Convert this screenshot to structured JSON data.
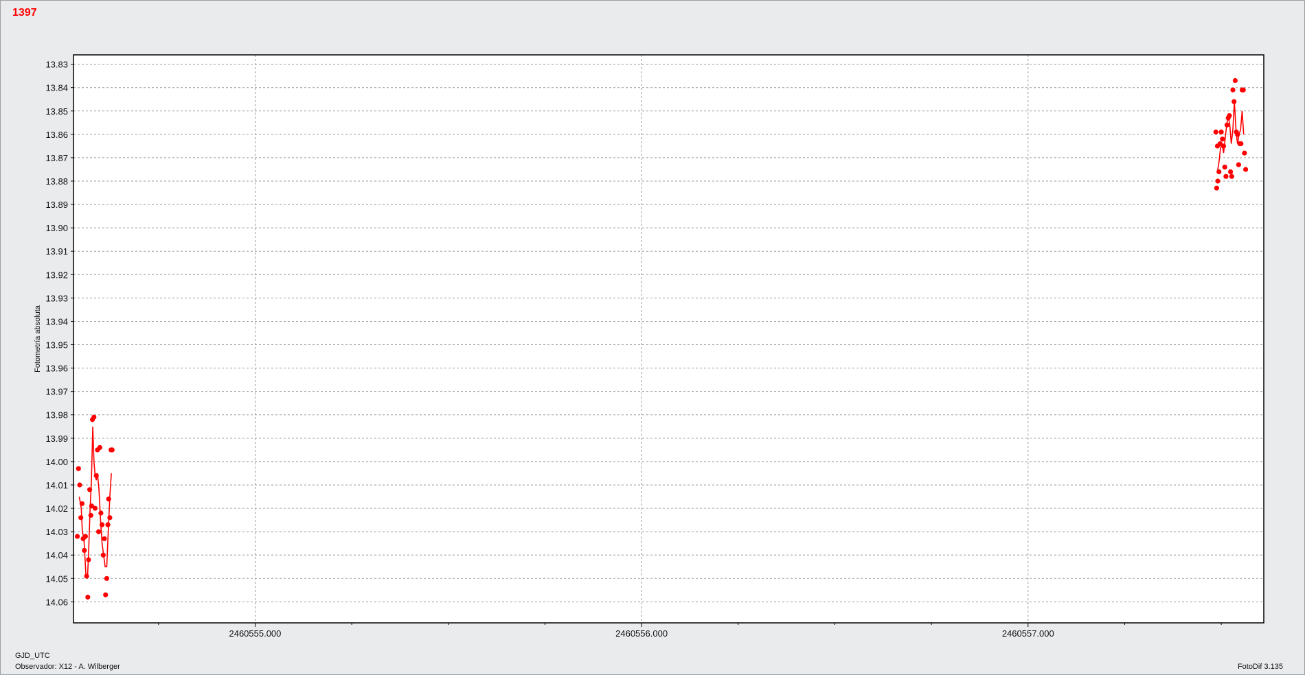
{
  "header": {
    "id_label": "1397",
    "id_color": "#ff0000"
  },
  "footer": {
    "xlabel": "GJD_UTC",
    "observer": "Observador: X12 - A. Wilberger",
    "version": "FotoDif 3.135"
  },
  "chart_data": {
    "type": "scatter",
    "title": "",
    "xlabel": "GJD_UTC",
    "ylabel": "Fotometría absoluta",
    "xlim": [
      2460554.53,
      2460557.61
    ],
    "ylim": [
      14.069,
      13.826
    ],
    "y_inverted": true,
    "grid": true,
    "x_ticks": [
      2460555.0,
      2460556.0,
      2460557.0
    ],
    "x_tick_labels": [
      "2460555.000",
      "2460556.000",
      "2460557.000"
    ],
    "y_ticks": [
      13.83,
      13.84,
      13.85,
      13.86,
      13.87,
      13.88,
      13.89,
      13.9,
      13.91,
      13.92,
      13.93,
      13.94,
      13.95,
      13.96,
      13.97,
      13.98,
      13.99,
      14.0,
      14.01,
      14.02,
      14.03,
      14.04,
      14.05,
      14.06
    ],
    "y_tick_labels": [
      "13.83",
      "13.84",
      "13.85",
      "13.86",
      "13.87",
      "13.88",
      "13.89",
      "13.90",
      "13.91",
      "13.92",
      "13.93",
      "13.94",
      "13.95",
      "13.96",
      "13.97",
      "13.98",
      "13.99",
      "14.00",
      "14.01",
      "14.02",
      "14.03",
      "14.04",
      "14.05",
      "14.06"
    ],
    "series_color": "#ff0000",
    "series": [
      {
        "points": [
          [
            2460554.54,
            14.032
          ],
          [
            2460554.543,
            14.003
          ],
          [
            2460554.546,
            14.01
          ],
          [
            2460554.549,
            14.024
          ],
          [
            2460554.552,
            14.018
          ],
          [
            2460554.555,
            14.033
          ],
          [
            2460554.558,
            14.038
          ],
          [
            2460554.561,
            14.032
          ],
          [
            2460554.564,
            14.049
          ],
          [
            2460554.567,
            14.058
          ],
          [
            2460554.569,
            14.042
          ],
          [
            2460554.572,
            14.012
          ],
          [
            2460554.575,
            14.023
          ],
          [
            2460554.577,
            14.019
          ],
          [
            2460554.579,
            13.982
          ],
          [
            2460554.583,
            13.981
          ],
          [
            2460554.586,
            14.02
          ],
          [
            2460554.589,
            14.006
          ],
          [
            2460554.592,
            13.995
          ],
          [
            2460554.595,
            14.03
          ],
          [
            2460554.598,
            13.994
          ],
          [
            2460554.601,
            14.022
          ],
          [
            2460554.604,
            14.027
          ],
          [
            2460554.607,
            14.04
          ],
          [
            2460554.61,
            14.033
          ],
          [
            2460554.613,
            14.057
          ],
          [
            2460554.616,
            14.05
          ],
          [
            2460554.619,
            14.027
          ],
          [
            2460554.621,
            14.016
          ],
          [
            2460554.624,
            14.024
          ],
          [
            2460554.627,
            13.995
          ],
          [
            2460554.63,
            13.995
          ]
        ],
        "trend": [
          [
            2460554.545,
            14.015
          ],
          [
            2460554.55,
            14.02
          ],
          [
            2460554.553,
            14.03
          ],
          [
            2460554.557,
            14.033
          ],
          [
            2460554.562,
            14.048
          ],
          [
            2460554.566,
            14.05
          ],
          [
            2460554.569,
            14.04
          ],
          [
            2460554.573,
            14.02
          ],
          [
            2460554.576,
            14.01
          ],
          [
            2460554.58,
            13.985
          ],
          [
            2460554.583,
            14.0
          ],
          [
            2460554.586,
            14.006
          ],
          [
            2460554.589,
            14.008
          ],
          [
            2460554.592,
            14.005
          ],
          [
            2460554.596,
            14.012
          ],
          [
            2460554.6,
            14.025
          ],
          [
            2460554.604,
            14.035
          ],
          [
            2460554.608,
            14.04
          ],
          [
            2460554.612,
            14.045
          ],
          [
            2460554.616,
            14.045
          ],
          [
            2460554.62,
            14.03
          ],
          [
            2460554.624,
            14.015
          ],
          [
            2460554.628,
            14.005
          ]
        ]
      },
      {
        "points": [
          [
            2460557.488,
            13.883
          ],
          [
            2460557.491,
            13.88
          ],
          [
            2460557.494,
            13.876
          ],
          [
            2460557.497,
            13.864
          ],
          [
            2460557.5,
            13.859
          ],
          [
            2460557.503,
            13.862
          ],
          [
            2460557.506,
            13.865
          ],
          [
            2460557.509,
            13.874
          ],
          [
            2460557.512,
            13.878
          ],
          [
            2460557.515,
            13.856
          ],
          [
            2460557.518,
            13.853
          ],
          [
            2460557.521,
            13.852
          ],
          [
            2460557.524,
            13.876
          ],
          [
            2460557.527,
            13.878
          ],
          [
            2460557.53,
            13.841
          ],
          [
            2460557.533,
            13.846
          ],
          [
            2460557.536,
            13.837
          ],
          [
            2460557.539,
            13.859
          ],
          [
            2460557.542,
            13.86
          ],
          [
            2460557.545,
            13.873
          ],
          [
            2460557.548,
            13.864
          ],
          [
            2460557.551,
            13.864
          ],
          [
            2460557.554,
            13.841
          ],
          [
            2460557.557,
            13.841
          ],
          [
            2460557.56,
            13.868
          ],
          [
            2460557.563,
            13.875
          ],
          [
            2460557.486,
            13.859
          ],
          [
            2460557.49,
            13.865
          ]
        ],
        "trend": [
          [
            2460557.49,
            13.876
          ],
          [
            2460557.494,
            13.872
          ],
          [
            2460557.498,
            13.866
          ],
          [
            2460557.502,
            13.864
          ],
          [
            2460557.506,
            13.868
          ],
          [
            2460557.51,
            13.862
          ],
          [
            2460557.514,
            13.856
          ],
          [
            2460557.518,
            13.852
          ],
          [
            2460557.522,
            13.856
          ],
          [
            2460557.526,
            13.864
          ],
          [
            2460557.53,
            13.858
          ],
          [
            2460557.534,
            13.846
          ],
          [
            2460557.538,
            13.858
          ],
          [
            2460557.542,
            13.864
          ],
          [
            2460557.546,
            13.86
          ],
          [
            2460557.55,
            13.858
          ],
          [
            2460557.554,
            13.85
          ],
          [
            2460557.558,
            13.86
          ]
        ]
      }
    ]
  }
}
